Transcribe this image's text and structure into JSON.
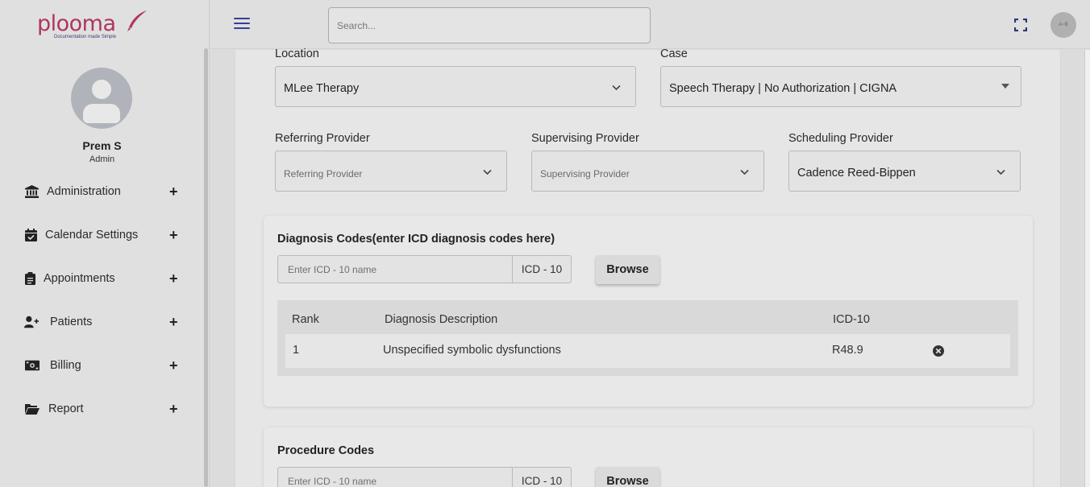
{
  "brand": {
    "name": "plooma",
    "tagline": "Documentation made Simple"
  },
  "user": {
    "name": "Prem S",
    "role": "Admin",
    "avatar_text": "A~B"
  },
  "search": {
    "placeholder": "Search..."
  },
  "nav": [
    {
      "label": "Administration",
      "icon": "bank-icon"
    },
    {
      "label": "Calendar Settings",
      "icon": "calendar-check-icon"
    },
    {
      "label": "Appointments",
      "icon": "clipboard-icon"
    },
    {
      "label": "Patients",
      "icon": "user-plus-icon"
    },
    {
      "label": "Billing",
      "icon": "money-icon"
    },
    {
      "label": "Report",
      "icon": "folder-open-icon"
    }
  ],
  "form": {
    "location": {
      "label": "Location",
      "value": "MLee Therapy"
    },
    "case": {
      "label": "Case",
      "value": "Speech Therapy | No Authorization | CIGNA"
    },
    "referring": {
      "label": "Referring Provider",
      "placeholder": "Referring Provider"
    },
    "supervising": {
      "label": "Supervising Provider",
      "placeholder": "Supervising Provider"
    },
    "scheduling": {
      "label": "Scheduling Provider",
      "value": "Cadence Reed-Bippen"
    }
  },
  "diagnosis": {
    "title": "Diagnosis Codes(enter ICD diagnosis codes here)",
    "input_placeholder": "Enter ICD - 10 name",
    "addon": "ICD - 10",
    "browse_label": "Browse",
    "columns": [
      "Rank",
      "Diagnosis Description",
      "ICD-10"
    ],
    "rows": [
      {
        "rank": "1",
        "description": "Unspecified symbolic dysfunctions",
        "code": "R48.9"
      }
    ]
  },
  "procedure": {
    "title": "Procedure Codes",
    "input_placeholder": "Enter ICD - 10 name",
    "addon": "ICD - 10",
    "browse_label": "Browse"
  },
  "colors": {
    "brand": "#b0355d",
    "menu_icon": "#3a3f8f"
  }
}
